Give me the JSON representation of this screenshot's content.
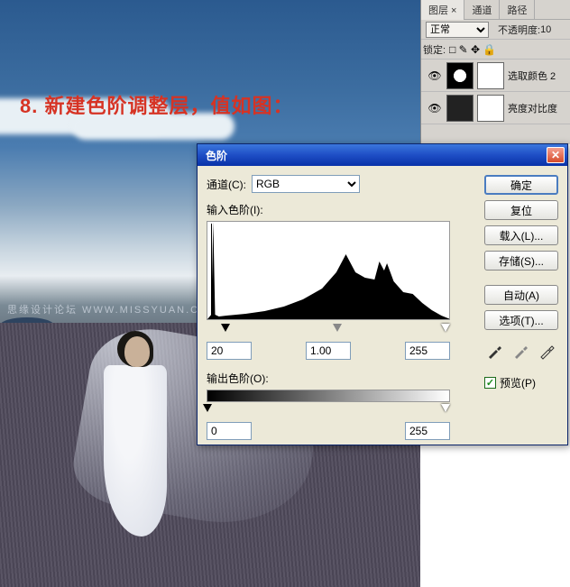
{
  "instruction": "8. 新建色阶调整层，值如图：",
  "watermark": "思缘设计论坛  WWW.MISSYUAN.COM",
  "layers_panel": {
    "tabs": {
      "layers": "图层 ×",
      "channels": "通道",
      "paths": "路径"
    },
    "blend_mode": "正常",
    "opacity_label": "不透明度:",
    "opacity_value": "10",
    "lock_label": "锁定:",
    "layers": [
      {
        "name": "选取颜色 2"
      },
      {
        "name": "亮度对比度"
      }
    ]
  },
  "dialog": {
    "title": "色阶",
    "channel_label": "通道(C):",
    "channel_value": "RGB",
    "input_label": "输入色阶(I):",
    "input_black": "20",
    "input_gamma": "1.00",
    "input_white": "255",
    "output_label": "输出色阶(O):",
    "output_black": "0",
    "output_white": "255",
    "btn_ok": "确定",
    "btn_reset": "复位",
    "btn_load": "载入(L)...",
    "btn_save": "存储(S)...",
    "btn_auto": "自动(A)",
    "btn_options": "选项(T)...",
    "preview_label": "预览(P)"
  },
  "chart_data": {
    "type": "area",
    "title": "输入色阶(I):",
    "xlabel": "",
    "ylabel": "",
    "xlim": [
      0,
      255
    ],
    "ylim": [
      0,
      110
    ],
    "x": [
      0,
      4,
      6,
      8,
      12,
      20,
      40,
      60,
      80,
      100,
      120,
      135,
      145,
      150,
      155,
      165,
      175,
      180,
      185,
      188,
      195,
      205,
      215,
      225,
      235,
      245,
      252,
      255
    ],
    "values": [
      0,
      5,
      108,
      5,
      3,
      4,
      6,
      9,
      14,
      22,
      34,
      52,
      72,
      62,
      52,
      46,
      44,
      64,
      54,
      62,
      42,
      30,
      28,
      18,
      10,
      4,
      1,
      0
    ]
  }
}
